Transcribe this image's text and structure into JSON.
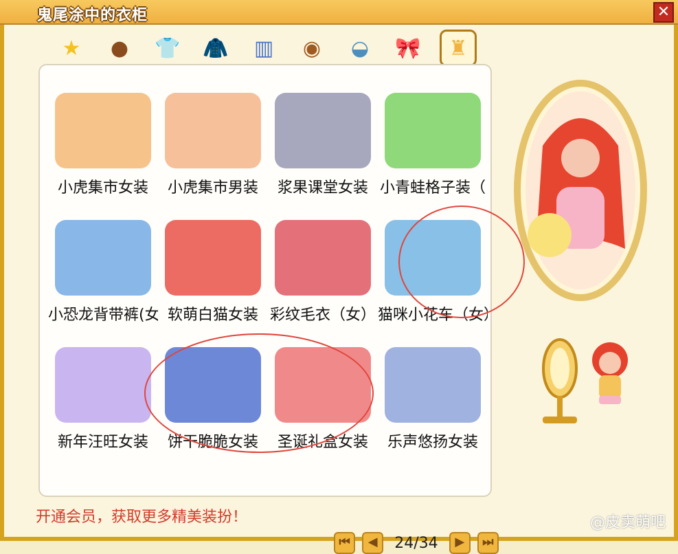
{
  "window": {
    "title": "鬼尾涂中的衣柜",
    "close_label": "✕"
  },
  "categories": [
    {
      "icon": "star-icon",
      "glyph": "★"
    },
    {
      "icon": "hair-icon",
      "glyph": "●"
    },
    {
      "icon": "shirt-icon",
      "glyph": "👕"
    },
    {
      "icon": "jacket-icon",
      "glyph": "🧥"
    },
    {
      "icon": "skirt-icon",
      "glyph": "▥"
    },
    {
      "icon": "face-accessory-icon",
      "glyph": "◉"
    },
    {
      "icon": "hat-icon",
      "glyph": "◒"
    },
    {
      "icon": "bow-icon",
      "glyph": "🎀"
    },
    {
      "icon": "full-outfit-icon",
      "glyph": "♜"
    }
  ],
  "items": [
    {
      "label": "小虎集市女装",
      "bg": "#f6c48a"
    },
    {
      "label": "小虎集市男装",
      "bg": "#f6c09a"
    },
    {
      "label": "浆果课堂女装",
      "bg": "#a7a7be"
    },
    {
      "label": "小青蛙格子装（",
      "bg": "#8fd97a"
    },
    {
      "label": "小恐龙背带裤(女",
      "bg": "#89b8e8"
    },
    {
      "label": "软萌白猫女装",
      "bg": "#ec6b62"
    },
    {
      "label": "彩纹毛衣（女）",
      "bg": "#e4707a"
    },
    {
      "label": "猫咪小花车（女）",
      "bg": "#88c0e8"
    },
    {
      "label": "新年汪旺女装",
      "bg": "#c9b6f0"
    },
    {
      "label": "饼干脆脆女装",
      "bg": "#6d88d6"
    },
    {
      "label": "圣诞礼盒女装",
      "bg": "#f08a8a"
    },
    {
      "label": "乐声悠扬女装",
      "bg": "#9fb2e0"
    }
  ],
  "pager": {
    "first": "⏮",
    "prev": "◀",
    "info": "24/34",
    "next": "▶",
    "last": "⏭"
  },
  "promo_text": "开通会员，获取更多精美装扮！",
  "watermark": "@皮卖萌吧"
}
